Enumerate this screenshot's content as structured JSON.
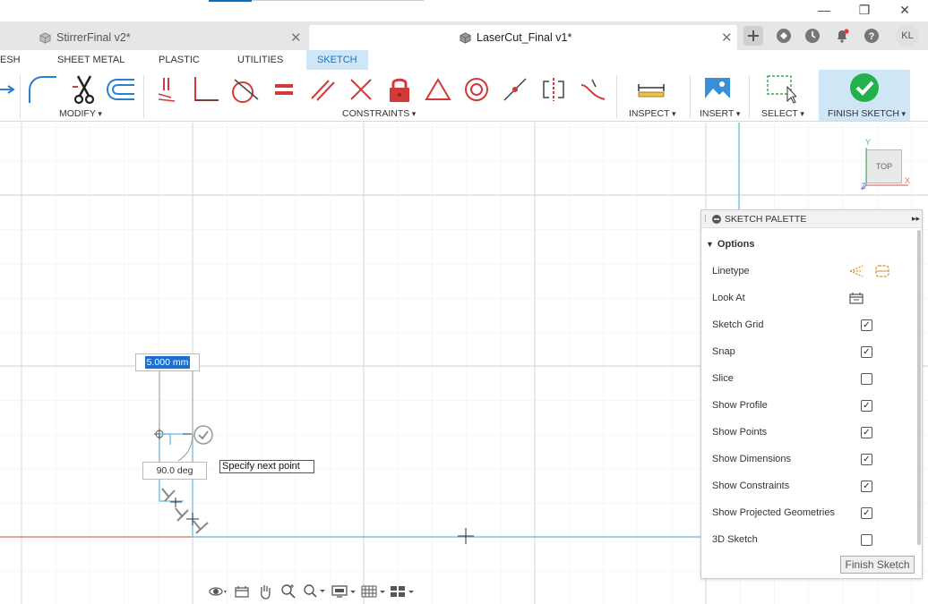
{
  "window": {
    "minimize": "—",
    "maximize": "❐",
    "close": "✕"
  },
  "tabs": [
    {
      "title": "StirrerFinal v2*"
    },
    {
      "title": "LaserCut_Final v1*"
    }
  ],
  "tab_close": "✕",
  "user_initials": "KL",
  "ribbon_tabs": [
    "ESH",
    "SHEET METAL",
    "PLASTIC",
    "UTILITIES",
    "SKETCH"
  ],
  "toolbar_groups": {
    "modify": "MODIFY",
    "constraints": "CONSTRAINTS",
    "inspect": "INSPECT",
    "insert": "INSERT",
    "select": "SELECT",
    "finish_sketch": "FINISH SKETCH"
  },
  "viewcube": {
    "face": "TOP",
    "axis_y": "Y",
    "axis_x": "X",
    "axis_z": "Z"
  },
  "palette": {
    "title": "SKETCH PALETTE",
    "section": "Options",
    "options": [
      {
        "label": "Linetype",
        "kind": "icons"
      },
      {
        "label": "Look At",
        "kind": "icon"
      },
      {
        "label": "Sketch Grid",
        "checked": true
      },
      {
        "label": "Snap",
        "checked": true
      },
      {
        "label": "Slice",
        "checked": false
      },
      {
        "label": "Show Profile",
        "checked": true
      },
      {
        "label": "Show Points",
        "checked": true
      },
      {
        "label": "Show Dimensions",
        "checked": true
      },
      {
        "label": "Show Constraints",
        "checked": true
      },
      {
        "label": "Show Projected Geometries",
        "checked": true
      },
      {
        "label": "3D Sketch",
        "checked": false
      }
    ],
    "finish_button": "Finish Sketch"
  },
  "sketch": {
    "dimension_value": "5.000 mm",
    "angle_value": "90.0 deg",
    "tooltip": "Specify next point"
  },
  "colors": {
    "accent": "#1a73c2",
    "ribbon_active_bg": "#cfe6f7",
    "finish_green": "#23b14d",
    "constraint_red": "#d23a3a",
    "sketch_line": "#7fc4e8",
    "x_axis": "#e07070"
  }
}
